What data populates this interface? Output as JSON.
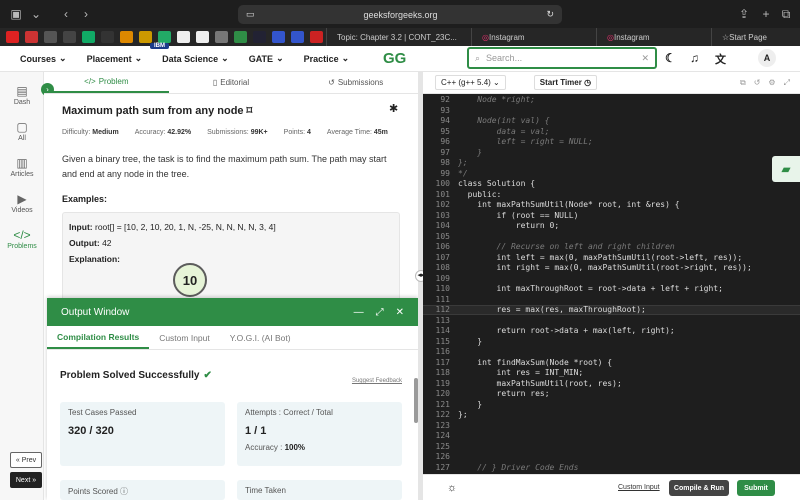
{
  "browser": {
    "url": "geeksforgeeks.org",
    "tabs": [
      "Topic: Chapter 3.2 | CONT_23C...",
      "Instagram",
      "Instagram",
      "Start Page"
    ]
  },
  "nav": {
    "logo": "GG",
    "items": [
      "Courses",
      "Placement",
      "Data Science",
      "GATE",
      "Practice"
    ],
    "badge": "IBM",
    "search_placeholder": "Search...",
    "avatar": "A"
  },
  "sidebar": {
    "items": [
      "Dash",
      "All",
      "Articles",
      "Videos",
      "Problems"
    ],
    "prev": "« Prev",
    "next": "Next »"
  },
  "problem": {
    "tabs": [
      "Problem",
      "Editorial",
      "Submissions"
    ],
    "title": "Maximum path sum from any node",
    "difficulty_label": "Difficulty:",
    "difficulty": "Medium",
    "accuracy_label": "Accuracy:",
    "accuracy": "42.92%",
    "submissions_label": "Submissions:",
    "submissions": "99K+",
    "points_label": "Points:",
    "points": "4",
    "avgtime_label": "Average Time:",
    "avgtime": "45m",
    "description": "Given a binary tree, the task is to find the maximum path sum. The path may start and end at any node in the tree.",
    "examples_label": "Examples:",
    "input_label": "Input:",
    "input": "root[] = [10, 2, 10, 20, 1, N, -25, N, N, N, N, 3, 4]",
    "output_label": "Output:",
    "output": "42",
    "explanation_label": "Explanation:",
    "tree_node": "10"
  },
  "output_window": {
    "title": "Output Window",
    "tabs": [
      "Compilation Results",
      "Custom Input",
      "Y.O.G.I. (AI Bot)"
    ],
    "status": "Problem Solved Successfully",
    "suggest": "Suggest Feedback",
    "testcases_label": "Test Cases Passed",
    "testcases": "320 / 320",
    "attempts_label": "Attempts : Correct / Total",
    "attempts": "1 / 1",
    "accuracy_label": "Accuracy :",
    "accuracy": "100%",
    "points_label": "Points Scored",
    "time_label": "Time Taken"
  },
  "editor": {
    "language": "C++ (g++ 5.4)",
    "timer": "Start Timer",
    "lines": [
      {
        "n": "92",
        "t": "    Node *right;",
        "c": "com"
      },
      {
        "n": "93",
        "t": "",
        "c": ""
      },
      {
        "n": "94",
        "t": "    Node(int val) {",
        "c": "com"
      },
      {
        "n": "95",
        "t": "        data = val;",
        "c": "com"
      },
      {
        "n": "96",
        "t": "        left = right = NULL;",
        "c": "com"
      },
      {
        "n": "97",
        "t": "    }",
        "c": "com"
      },
      {
        "n": "98",
        "t": "};",
        "c": "com"
      },
      {
        "n": "99",
        "t": "*/",
        "c": "com"
      },
      {
        "n": "100",
        "t": "class Solution {",
        "c": ""
      },
      {
        "n": "101",
        "t": "  public:",
        "c": ""
      },
      {
        "n": "102",
        "t": "    int maxPathSumUtil(Node* root, int &res) {",
        "c": ""
      },
      {
        "n": "103",
        "t": "        if (root == NULL)",
        "c": ""
      },
      {
        "n": "104",
        "t": "            return 0;",
        "c": ""
      },
      {
        "n": "105",
        "t": "",
        "c": ""
      },
      {
        "n": "106",
        "t": "        // Recurse on left and right children",
        "c": "com"
      },
      {
        "n": "107",
        "t": "        int left = max(0, maxPathSumUtil(root->left, res));",
        "c": ""
      },
      {
        "n": "108",
        "t": "        int right = max(0, maxPathSumUtil(root->right, res));",
        "c": ""
      },
      {
        "n": "109",
        "t": "",
        "c": ""
      },
      {
        "n": "110",
        "t": "        int maxThroughRoot = root->data + left + right;",
        "c": ""
      },
      {
        "n": "111",
        "t": "",
        "c": ""
      },
      {
        "n": "112",
        "t": "        res = max(res, maxThroughRoot);",
        "c": "hl"
      },
      {
        "n": "113",
        "t": "",
        "c": ""
      },
      {
        "n": "114",
        "t": "        return root->data + max(left, right);",
        "c": ""
      },
      {
        "n": "115",
        "t": "    }",
        "c": ""
      },
      {
        "n": "116",
        "t": "",
        "c": ""
      },
      {
        "n": "117",
        "t": "    int findMaxSum(Node *root) {",
        "c": ""
      },
      {
        "n": "118",
        "t": "        int res = INT_MIN;",
        "c": ""
      },
      {
        "n": "119",
        "t": "        maxPathSumUtil(root, res);",
        "c": ""
      },
      {
        "n": "120",
        "t": "        return res;",
        "c": ""
      },
      {
        "n": "121",
        "t": "    }",
        "c": ""
      },
      {
        "n": "122",
        "t": "};",
        "c": ""
      },
      {
        "n": "123",
        "t": "",
        "c": ""
      },
      {
        "n": "124",
        "t": "",
        "c": ""
      },
      {
        "n": "125",
        "t": "",
        "c": ""
      },
      {
        "n": "126",
        "t": "",
        "c": ""
      },
      {
        "n": "127",
        "t": "    // } Driver Code Ends",
        "c": "com"
      }
    ],
    "custom_input": "Custom Input",
    "compile": "Compile & Run",
    "submit": "Submit"
  }
}
